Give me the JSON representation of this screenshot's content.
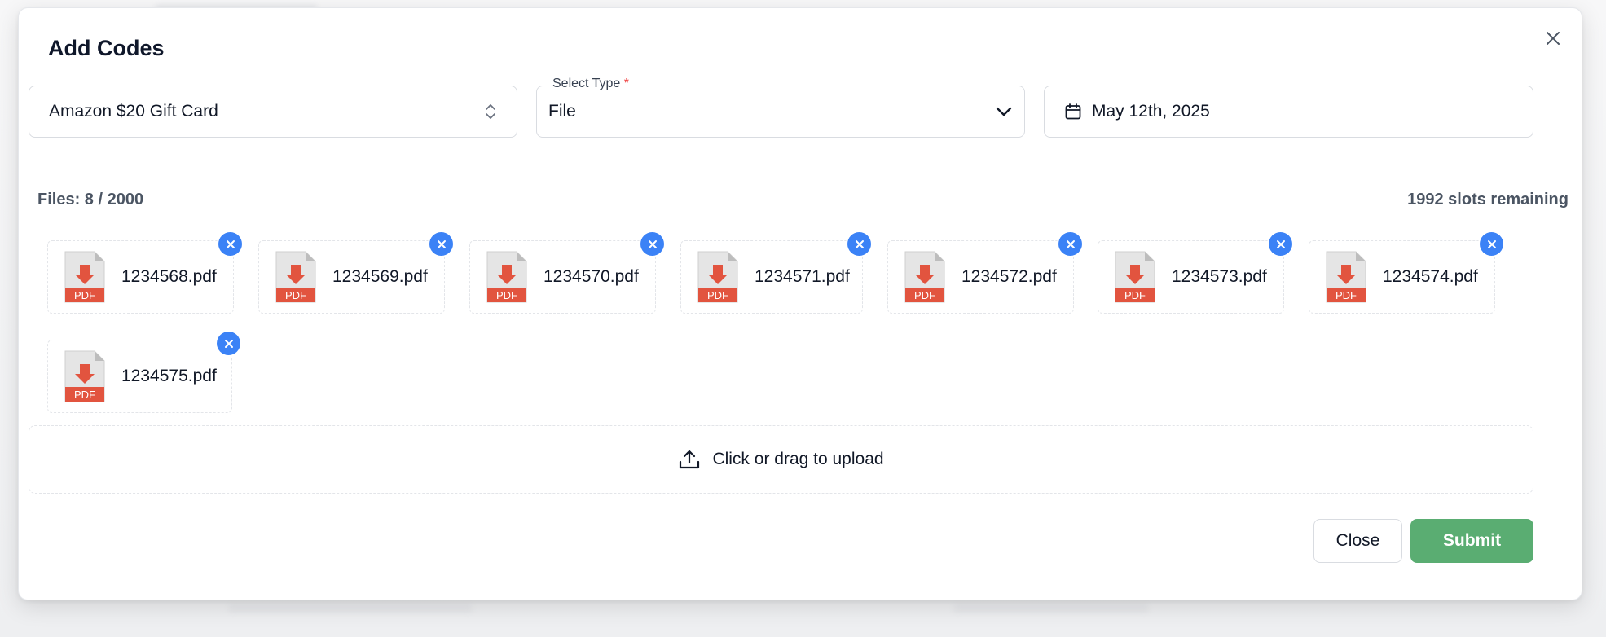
{
  "modal": {
    "title": "Add Codes"
  },
  "product_select": {
    "value": "Amazon $20 Gift Card"
  },
  "type_select": {
    "label": "Select Type",
    "required_mark": "*",
    "value": "File"
  },
  "date_picker": {
    "value": "May 12th, 2025"
  },
  "files": {
    "count_label": "Files: 8 / 2000",
    "remaining_label": "1992 slots remaining",
    "items": [
      {
        "name": "1234568.pdf",
        "badge": "PDF"
      },
      {
        "name": "1234569.pdf",
        "badge": "PDF"
      },
      {
        "name": "1234570.pdf",
        "badge": "PDF"
      },
      {
        "name": "1234571.pdf",
        "badge": "PDF"
      },
      {
        "name": "1234572.pdf",
        "badge": "PDF"
      },
      {
        "name": "1234573.pdf",
        "badge": "PDF"
      },
      {
        "name": "1234574.pdf",
        "badge": "PDF"
      },
      {
        "name": "1234575.pdf",
        "badge": "PDF"
      }
    ]
  },
  "upload": {
    "label": "Click or drag to upload"
  },
  "footer": {
    "close_label": "Close",
    "submit_label": "Submit"
  },
  "colors": {
    "accent_blue": "#3b82f6",
    "submit_green": "#5aad72",
    "pdf_red": "#e2543f"
  }
}
